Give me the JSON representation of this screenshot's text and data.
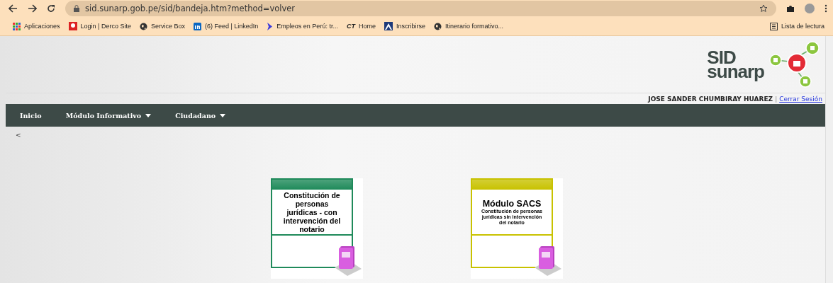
{
  "browser": {
    "url": "sid.sunarp.gob.pe/sid/bandeja.htm?method=volver",
    "bookmarks": [
      {
        "kind": "grid",
        "label": "Aplicaciones"
      },
      {
        "kind": "derco",
        "label": "Login | Derco Site"
      },
      {
        "kind": "globe",
        "label": "Service Box"
      },
      {
        "kind": "linkedin",
        "label": "(6) Feed | LinkedIn"
      },
      {
        "kind": "chevron",
        "label": "Empleos en Perú: tr..."
      },
      {
        "kind": "text",
        "icon_text": "CT",
        "label": "Home"
      },
      {
        "kind": "peak",
        "label": "Inscribirse"
      },
      {
        "kind": "globe",
        "label": "Itinerario formativo..."
      }
    ],
    "reading_list": "Lista de lectura"
  },
  "header": {
    "logo_lines": [
      "SID",
      "sunarp"
    ],
    "user_name": "JOSE SANDER CHUMBIRAY HUAREZ",
    "separator": "|",
    "logout": "Cerrar Sesión"
  },
  "nav": [
    {
      "label": "Inicio",
      "has_menu": false
    },
    {
      "label": "Módulo Informativo",
      "has_menu": true
    },
    {
      "label": "Ciudadano",
      "has_menu": true
    }
  ],
  "back": "<",
  "cards": [
    {
      "color": "#1f8a5a",
      "text": "Constitución de personas jurídicas - con intervención del notario"
    },
    {
      "color": "#c8c200",
      "title": "Módulo SACS",
      "text": "Constitución de personas jurídicas sin intervención del notario"
    }
  ]
}
